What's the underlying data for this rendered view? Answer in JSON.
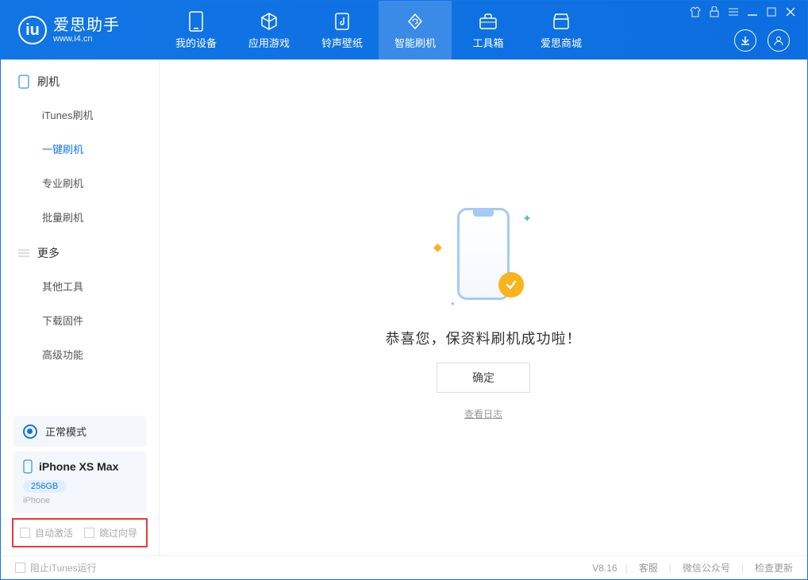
{
  "app": {
    "name": "爱思助手",
    "domain": "www.i4.cn"
  },
  "nav": [
    {
      "label": "我的设备",
      "icon": "device"
    },
    {
      "label": "应用游戏",
      "icon": "cube"
    },
    {
      "label": "铃声壁纸",
      "icon": "music"
    },
    {
      "label": "智能刷机",
      "icon": "refresh",
      "active": true
    },
    {
      "label": "工具箱",
      "icon": "toolbox"
    },
    {
      "label": "爱思商城",
      "icon": "store"
    }
  ],
  "sidebar": {
    "group1_title": "刷机",
    "group1_items": [
      {
        "label": "iTunes刷机"
      },
      {
        "label": "一键刷机",
        "active": true
      },
      {
        "label": "专业刷机"
      },
      {
        "label": "批量刷机"
      }
    ],
    "group2_title": "更多",
    "group2_items": [
      {
        "label": "其他工具"
      },
      {
        "label": "下载固件"
      },
      {
        "label": "高级功能"
      }
    ]
  },
  "mode": {
    "label": "正常模式"
  },
  "device": {
    "name": "iPhone XS Max",
    "capacity": "256GB",
    "type": "iPhone"
  },
  "options": {
    "auto_activate": "自动激活",
    "skip_guide": "跳过向导"
  },
  "main": {
    "headline": "恭喜您，保资料刷机成功啦！",
    "ok": "确定",
    "view_log": "查看日志"
  },
  "footer": {
    "block_itunes": "阻止iTunes运行",
    "version": "V8.16",
    "links": [
      "客服",
      "微信公众号",
      "检查更新"
    ]
  }
}
